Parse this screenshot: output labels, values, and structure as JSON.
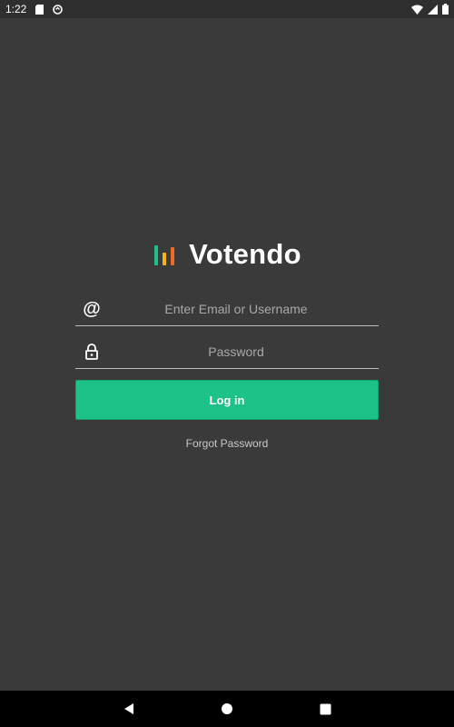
{
  "status_bar": {
    "time": "1:22",
    "left_icons": [
      "sd-card-icon",
      "sync-icon"
    ],
    "right_icons": [
      "wifi-icon",
      "signal-icon",
      "battery-icon"
    ]
  },
  "logo": {
    "text": "Votendo",
    "mark_colors": [
      "#1dc386",
      "#f5b315",
      "#ef6b2a"
    ]
  },
  "form": {
    "email_placeholder": "Enter Email or Username",
    "email_value": "",
    "password_placeholder": "Password",
    "password_value": "",
    "login_label": "Log in",
    "forgot_label": "Forgot Password"
  },
  "nav_bar": {
    "buttons": [
      "back-icon",
      "home-icon",
      "recents-icon"
    ]
  },
  "colors": {
    "background": "#3a3a3a",
    "accent": "#1dc386"
  }
}
